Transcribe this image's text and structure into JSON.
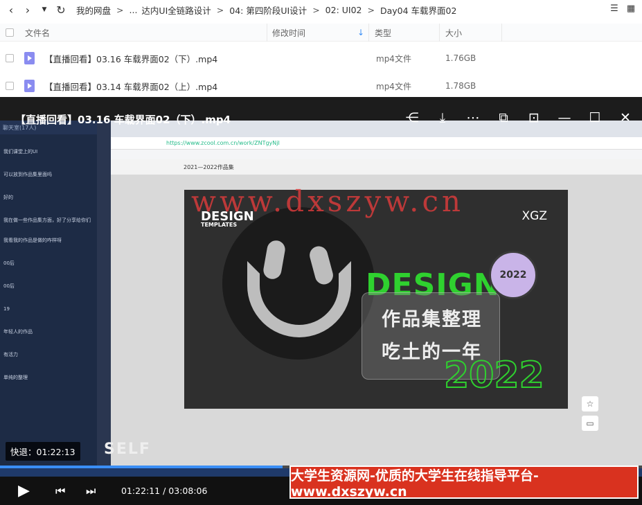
{
  "breadcrumb": [
    "我的网盘",
    "...",
    "达内UI全链路设计",
    "04: 第四阶段UI设计",
    "02: UI02",
    "Day04 车载界面02"
  ],
  "columns": {
    "name": "文件名",
    "modified": "修改时间",
    "type": "类型",
    "size": "大小"
  },
  "files": [
    {
      "name": "【直播回看】03.16 车载界面02（下）.mp4",
      "type": "mp4文件",
      "size": "1.76GB"
    },
    {
      "name": "【直播回看】03.14 车载界面02（上）.mp4",
      "type": "mp4文件",
      "size": "1.78GB"
    }
  ],
  "player": {
    "title": "【直播回看】03.16 车载界面02（下）.mp4",
    "seek_tooltip": "快退：01:22:13",
    "time": "01:22:11 / 03:08:06",
    "progress_fraction": 0.44
  },
  "video_content": {
    "chat_title": "聊天室(17人)",
    "chat_lines": [
      "我们课堂上的UI",
      "可以放到作品集里面吗",
      "好的",
      "我在做一些作品集方面，好了分享给你们",
      "我看我的作品是做的咋样呀",
      "00后",
      "00后",
      "19",
      "年轻人的作品",
      "有活力",
      "单纯的整理"
    ],
    "url": "https://www.zcool.com.cn/work/ZNTgyNjI",
    "page_header": "2021—2022作品集",
    "art_title": "DESIGN",
    "art_subtitle": "TEMPLATES",
    "art_brand": "XGZ",
    "art_design": "DESIGN",
    "art_line1": "作品集整理",
    "art_line2": "吃土的一年",
    "art_year": "2022",
    "art_badge": "2022",
    "art_bottom": "SELF",
    "watermark": "www.dxszyw.cn"
  },
  "ad_banner": "大学生资源网-优质的大学生在线指导平台-www.dxszyw.cn",
  "colors": {
    "accent": "#3a8ef6",
    "design_green": "#2fd12f",
    "ad_red": "#d9321f"
  }
}
